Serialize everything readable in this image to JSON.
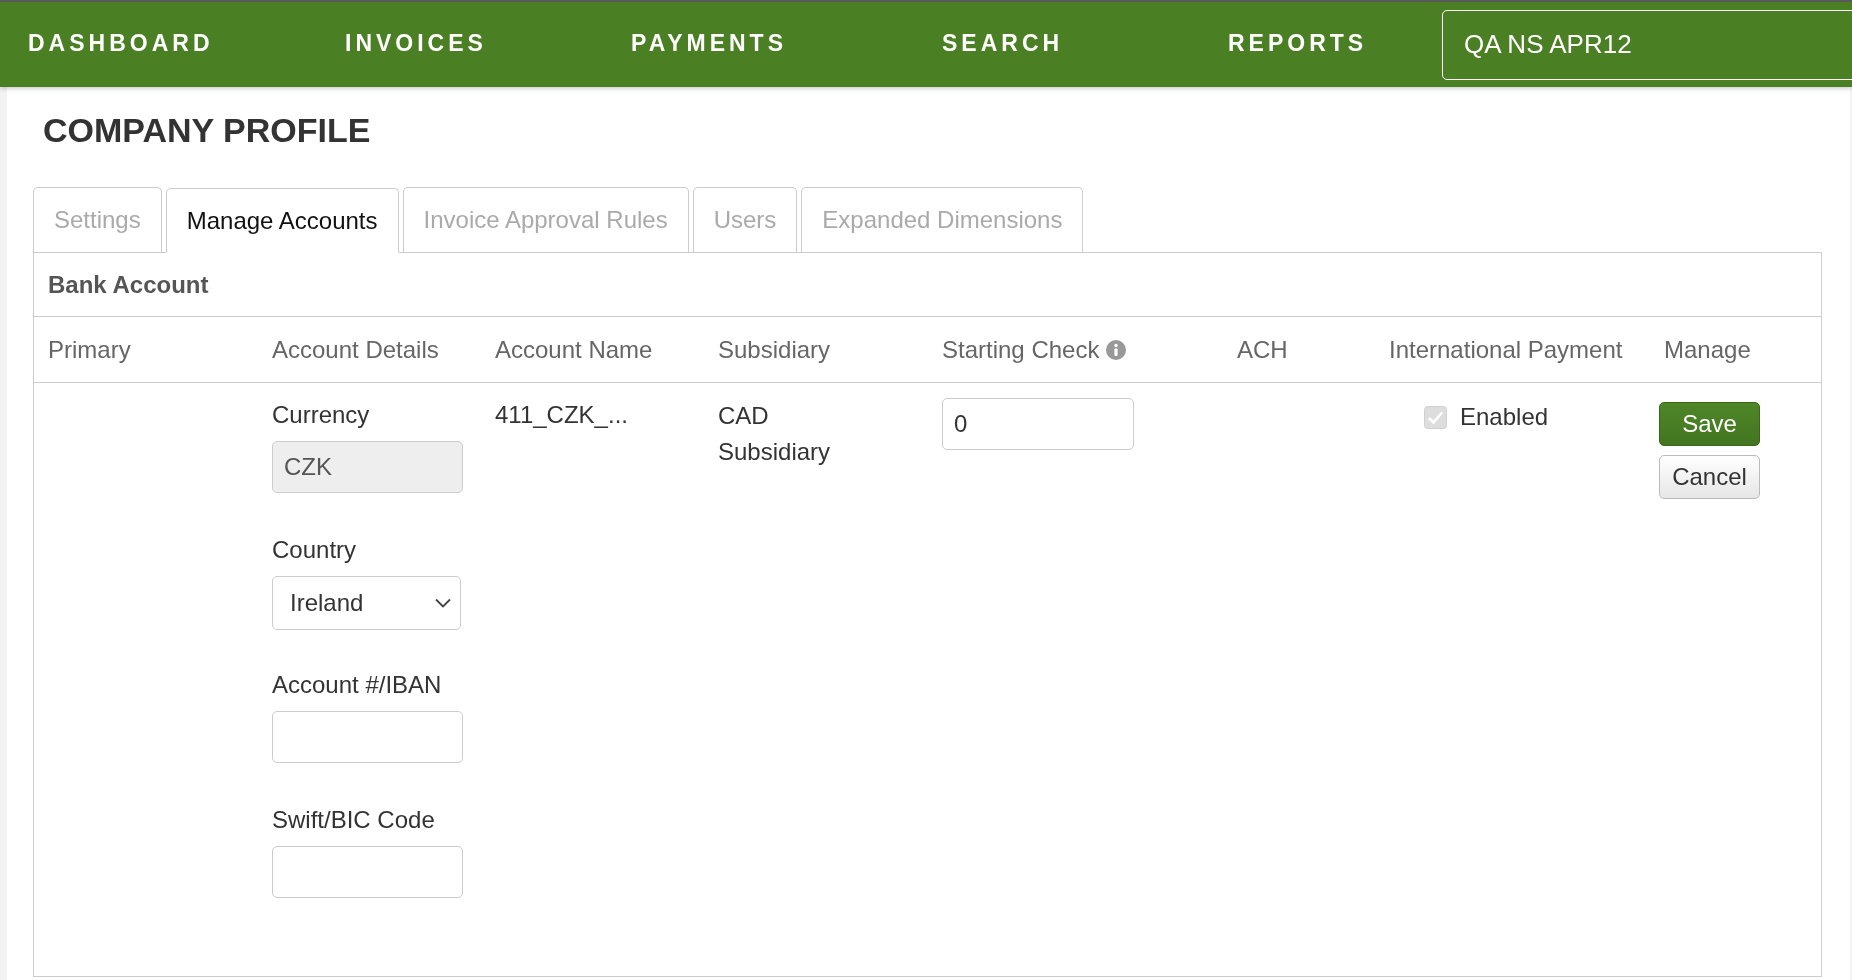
{
  "nav": {
    "items": [
      {
        "label": "DASHBOARD",
        "selected": false
      },
      {
        "label": "INVOICES",
        "selected": false
      },
      {
        "label": "PAYMENTS",
        "selected": false
      },
      {
        "label": "SEARCH",
        "selected": false
      },
      {
        "label": "REPORTS",
        "selected": false
      }
    ],
    "account": "QA NS APR12"
  },
  "page_title": "COMPANY PROFILE",
  "tabs": [
    {
      "label": "Settings",
      "selected": false
    },
    {
      "label": "Manage Accounts",
      "selected": true
    },
    {
      "label": "Invoice Approval Rules",
      "selected": false
    },
    {
      "label": "Users",
      "selected": false
    },
    {
      "label": "Expanded Dimensions",
      "selected": false
    }
  ],
  "panel": {
    "title": "Bank Account",
    "table": {
      "columns": [
        {
          "label": "Primary",
          "info_icon": false
        },
        {
          "label": "Account Details",
          "info_icon": false
        },
        {
          "label": "Account Name",
          "info_icon": false
        },
        {
          "label": "Subsidiary",
          "info_icon": false
        },
        {
          "label": "Starting Check",
          "info_icon": true
        },
        {
          "label": "ACH",
          "info_icon": false
        },
        {
          "label": "International Payment",
          "info_icon": false
        },
        {
          "label": "Manage",
          "info_icon": false
        }
      ],
      "rows": [
        {
          "account_details": [
            {
              "kind": "readonly",
              "label": "Currency",
              "value": "CZK"
            },
            {
              "kind": "select",
              "label": "Country",
              "value": "Ireland"
            },
            {
              "kind": "text",
              "label": "Account #/IBAN"
            },
            {
              "kind": "text",
              "label": "Swift/BIC Code"
            }
          ],
          "account_name": "411_CZK_...",
          "subsidiary": "CAD Subsidiary",
          "starting_check": "0",
          "international_payment": {
            "checked": true,
            "disabled": true,
            "label": "Enabled"
          },
          "actions": [
            {
              "kind": "primary",
              "label": "Save"
            },
            {
              "kind": "secondary",
              "label": "Cancel"
            }
          ]
        }
      ]
    }
  }
}
